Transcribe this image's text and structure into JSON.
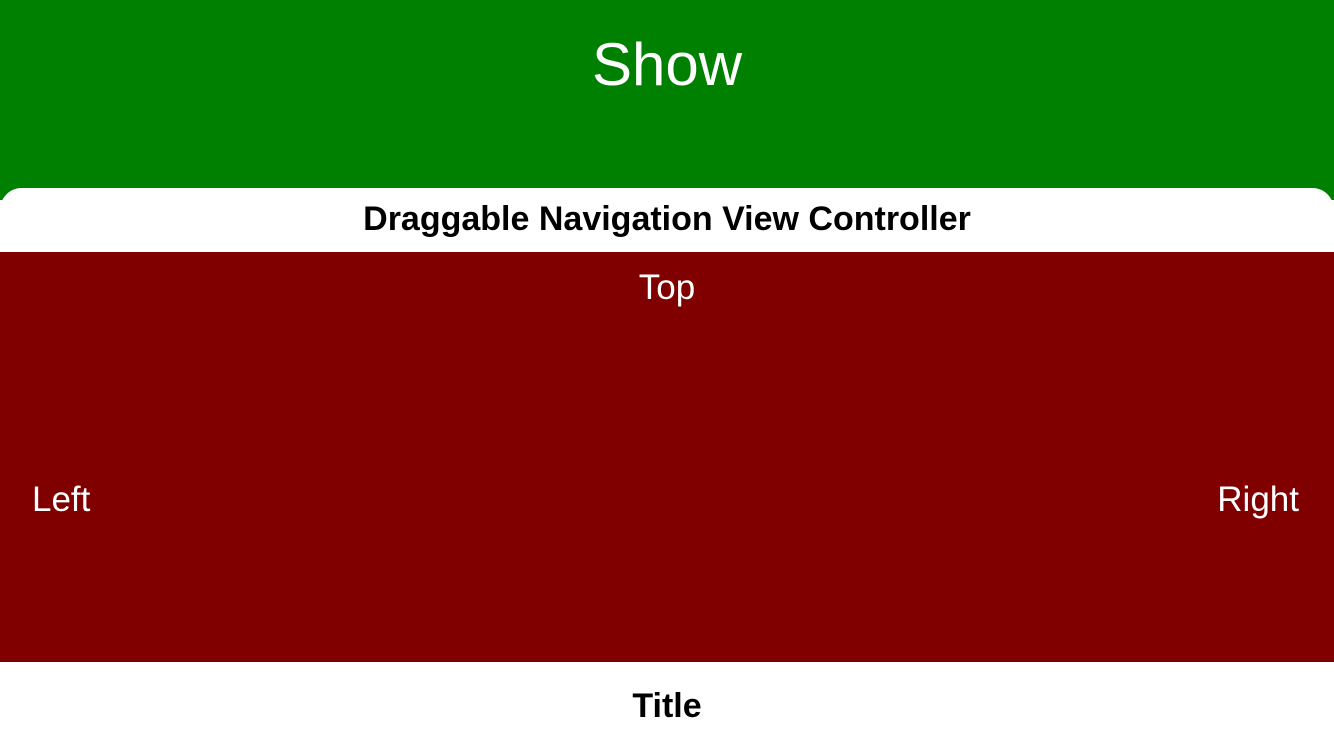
{
  "colors": {
    "show_background": "#008000",
    "content_background": "#800000",
    "sheet_background": "#ffffff",
    "label_text": "#ffffff",
    "title_text": "#000000"
  },
  "show_area": {
    "button_label": "Show"
  },
  "sheet": {
    "nav_title": "Draggable Navigation View Controller",
    "content": {
      "top_label": "Top",
      "left_label": "Left",
      "right_label": "Right"
    },
    "bottom_title": "Title"
  }
}
